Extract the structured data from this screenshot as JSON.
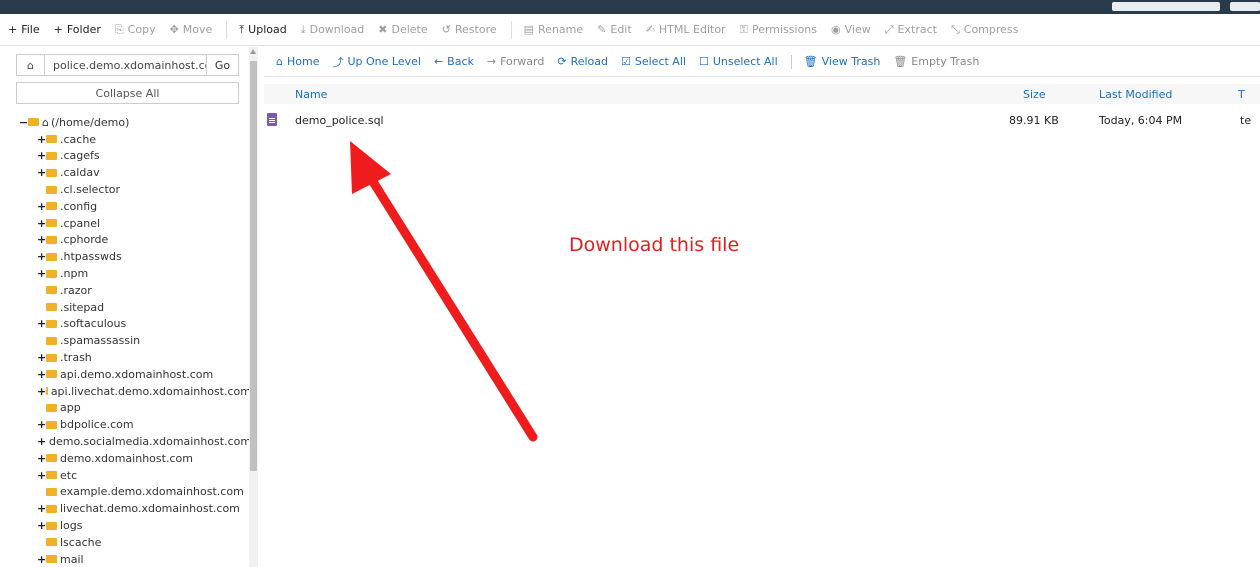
{
  "toolbar": {
    "items": [
      {
        "label": "File",
        "icon": "+",
        "enabled": true
      },
      {
        "label": "Folder",
        "icon": "+",
        "enabled": true
      },
      {
        "label": "Copy",
        "icon": "⎘",
        "enabled": false
      },
      {
        "label": "Move",
        "icon": "✥",
        "enabled": false
      },
      {
        "label": "Upload",
        "icon": "⤒",
        "enabled": true
      },
      {
        "label": "Download",
        "icon": "⤓",
        "enabled": false
      },
      {
        "label": "Delete",
        "icon": "✖",
        "enabled": false
      },
      {
        "label": "Restore",
        "icon": "↺",
        "enabled": false
      },
      {
        "label": "Rename",
        "icon": "▤",
        "enabled": false
      },
      {
        "label": "Edit",
        "icon": "✎",
        "enabled": false
      },
      {
        "label": "HTML Editor",
        "icon": "✍",
        "enabled": false
      },
      {
        "label": "Permissions",
        "icon": "⚿",
        "enabled": false
      },
      {
        "label": "View",
        "icon": "◉",
        "enabled": false
      },
      {
        "label": "Extract",
        "icon": "⤢",
        "enabled": false
      },
      {
        "label": "Compress",
        "icon": "⤡",
        "enabled": false
      }
    ]
  },
  "sidebar": {
    "address_value": "police.demo.xdomainhost.com",
    "go_label": "Go",
    "collapse_label": "Collapse All",
    "root_label": "(/home/demo)",
    "items": [
      {
        "label": ".cache",
        "expandable": true
      },
      {
        "label": ".cagefs",
        "expandable": true
      },
      {
        "label": ".caldav",
        "expandable": true
      },
      {
        "label": ".cl.selector",
        "expandable": false
      },
      {
        "label": ".config",
        "expandable": true
      },
      {
        "label": ".cpanel",
        "expandable": true
      },
      {
        "label": ".cphorde",
        "expandable": true
      },
      {
        "label": ".htpasswds",
        "expandable": true
      },
      {
        "label": ".npm",
        "expandable": true
      },
      {
        "label": ".razor",
        "expandable": false
      },
      {
        "label": ".sitepad",
        "expandable": false
      },
      {
        "label": ".softaculous",
        "expandable": true
      },
      {
        "label": ".spamassassin",
        "expandable": false
      },
      {
        "label": ".trash",
        "expandable": true
      },
      {
        "label": "api.demo.xdomainhost.com",
        "expandable": true
      },
      {
        "label": "api.livechat.demo.xdomainhost.com",
        "expandable": true
      },
      {
        "label": "app",
        "expandable": false
      },
      {
        "label": "bdpolice.com",
        "expandable": true
      },
      {
        "label": "demo.socialmedia.xdomainhost.com",
        "expandable": true
      },
      {
        "label": "demo.xdomainhost.com",
        "expandable": true
      },
      {
        "label": "etc",
        "expandable": true
      },
      {
        "label": "example.demo.xdomainhost.com",
        "expandable": false
      },
      {
        "label": "livechat.demo.xdomainhost.com",
        "expandable": true
      },
      {
        "label": "logs",
        "expandable": true
      },
      {
        "label": "lscache",
        "expandable": false
      },
      {
        "label": "mail",
        "expandable": true
      }
    ]
  },
  "actions": {
    "items": [
      {
        "label": "Home",
        "icon": "⌂",
        "enabled": true
      },
      {
        "label": "Up One Level",
        "icon": "⤴",
        "enabled": true
      },
      {
        "label": "Back",
        "icon": "←",
        "enabled": true
      },
      {
        "label": "Forward",
        "icon": "→",
        "enabled": false
      },
      {
        "label": "Reload",
        "icon": "⟳",
        "enabled": true
      },
      {
        "label": "Select All",
        "icon": "☑",
        "enabled": true
      },
      {
        "label": "Unselect All",
        "icon": "☐",
        "enabled": true
      },
      {
        "label": "View Trash",
        "icon": "🗑",
        "enabled": true
      },
      {
        "label": "Empty Trash",
        "icon": "🗑",
        "enabled": false
      }
    ]
  },
  "table": {
    "columns": {
      "name": "Name",
      "size": "Size",
      "modified": "Last Modified",
      "type": "T"
    },
    "rows": [
      {
        "name": "demo_police.sql",
        "size": "89.91 KB",
        "modified": "Today, 6:04 PM",
        "type": "te"
      }
    ]
  },
  "annotation": {
    "text": "Download this file",
    "color": "#e02020"
  },
  "colors": {
    "link": "#1b6ec2",
    "folder": "#f0b128",
    "file": "#7b5aa6",
    "topbar": "#293a4a"
  }
}
